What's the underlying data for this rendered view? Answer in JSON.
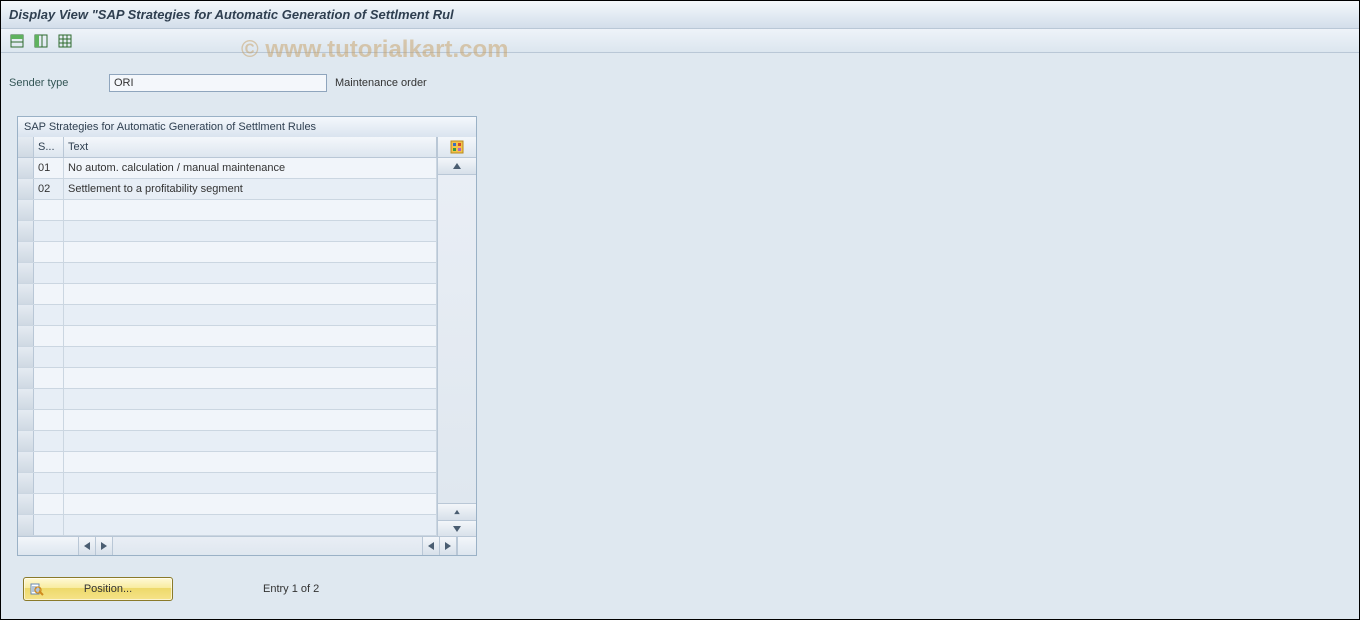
{
  "window": {
    "title": "Display View \"SAP Strategies for Automatic Generation of Settlment Rul"
  },
  "toolbar": {
    "icons": [
      "table-row-icon",
      "table-col-icon",
      "table-grid-icon"
    ]
  },
  "watermark": {
    "text": "© www.tutorialkart.com"
  },
  "form": {
    "sender_type_label": "Sender type",
    "sender_type_value": "ORI",
    "sender_type_desc": "Maintenance order"
  },
  "table": {
    "title": "SAP Strategies for Automatic Generation of Settlment Rules",
    "columns": {
      "s": "S...",
      "text": "Text"
    },
    "rows": [
      {
        "s": "01",
        "text": "No autom. calculation / manual maintenance"
      },
      {
        "s": "02",
        "text": "Settlement to a profitability segment"
      }
    ],
    "empty_row_count": 16
  },
  "footer": {
    "position_label": "Position...",
    "entry_label": "Entry 1 of 2"
  }
}
